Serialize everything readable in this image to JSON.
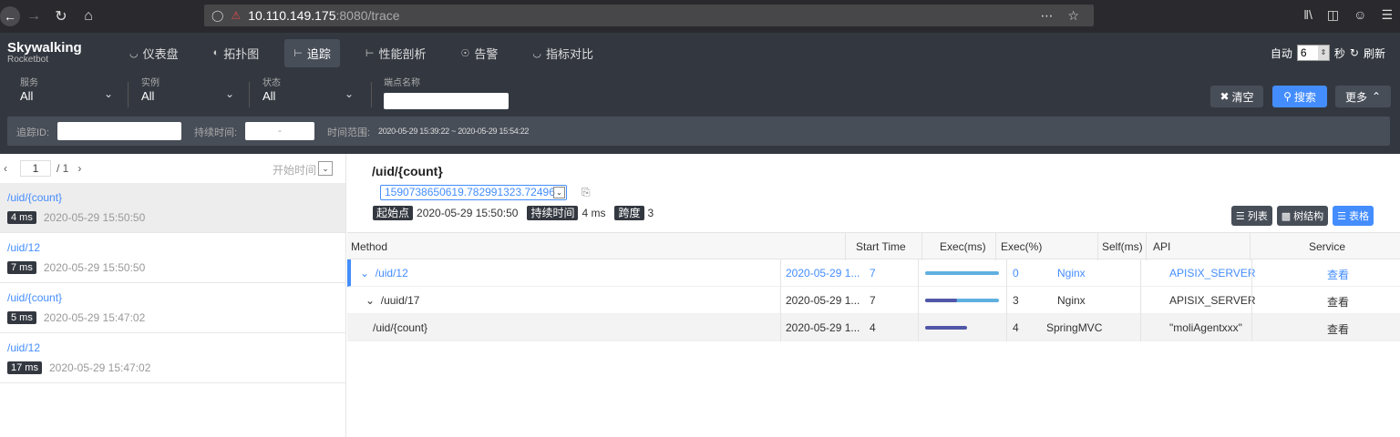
{
  "browser": {
    "url_host": "10.110.149.175",
    "url_rest": ":8080/trace"
  },
  "app": {
    "logo": "Skywalking",
    "logo_sub": "Rocketbot",
    "menu": [
      {
        "label": "仪表盘"
      },
      {
        "label": "拓扑图"
      },
      {
        "label": "追踪"
      },
      {
        "label": "性能剖析"
      },
      {
        "label": "告警"
      },
      {
        "label": "指标对比"
      }
    ],
    "auto_label": "自动",
    "auto_value": "6",
    "seconds_label": "秒",
    "refresh_label": "刷新"
  },
  "filters": {
    "service_label": "服务",
    "service_value": "All",
    "instance_label": "实例",
    "instance_value": "All",
    "state_label": "状态",
    "state_value": "All",
    "endpoint_label": "端点名称",
    "endpoint_value": "",
    "clear_label": "清空",
    "search_label": "搜索",
    "more_label": "更多",
    "trace_id_label": "追踪ID:",
    "trace_id_value": "",
    "duration_label": "持续时间:",
    "duration_value": "-",
    "time_range_label": "时间范围:",
    "time_range_value": "2020-05-29 15:39:22 ~ 2020-05-29 15:54:22"
  },
  "list": {
    "page_current": "1",
    "page_total": "/ 1",
    "sort_label": "开始时间",
    "items": [
      {
        "endpoint": "/uid/{count}",
        "duration": "4 ms",
        "time": "2020-05-29 15:50:50"
      },
      {
        "endpoint": "/uid/12",
        "duration": "7 ms",
        "time": "2020-05-29 15:50:50"
      },
      {
        "endpoint": "/uid/{count}",
        "duration": "5 ms",
        "time": "2020-05-29 15:47:02"
      },
      {
        "endpoint": "/uid/12",
        "duration": "17 ms",
        "time": "2020-05-29 15:47:02"
      }
    ]
  },
  "detail": {
    "title": "/uid/{count}",
    "trace_id": "1590738650619.782991323.72496",
    "start_label": "起始点",
    "start_value": "2020-05-29 15:50:50",
    "duration_label": "持续时间",
    "duration_value": "4 ms",
    "span_label": "跨度",
    "span_value": "3",
    "view_list": "列表",
    "view_tree": "树结构",
    "view_table": "表格"
  },
  "table": {
    "headers": {
      "method": "Method",
      "start_time": "Start Time",
      "exec_ms": "Exec(ms)",
      "exec_pct": "Exec(%)",
      "self_ms": "Self(ms)",
      "api": "API",
      "service": "Service"
    },
    "rows": [
      {
        "method": "/uid/12",
        "start": "2020-05-29 1...",
        "exec_ms": "7",
        "exec_pct": 1.0,
        "self_ms": "0",
        "api": "Nginx",
        "service": "APISIX_SERVER",
        "action": "查看"
      },
      {
        "method": "/uuid/17",
        "start": "2020-05-29 1...",
        "exec_ms": "7",
        "exec_pct": 1.0,
        "self_ms": "3",
        "api": "Nginx",
        "service": "APISIX_SERVER",
        "action": "查看"
      },
      {
        "method": "/uid/{count}",
        "start": "2020-05-29 1...",
        "exec_ms": "4",
        "exec_pct": 0.57,
        "self_ms": "4",
        "api": "SpringMVC",
        "service": "\"moliAgentxxx\"",
        "action": "查看"
      }
    ]
  }
}
